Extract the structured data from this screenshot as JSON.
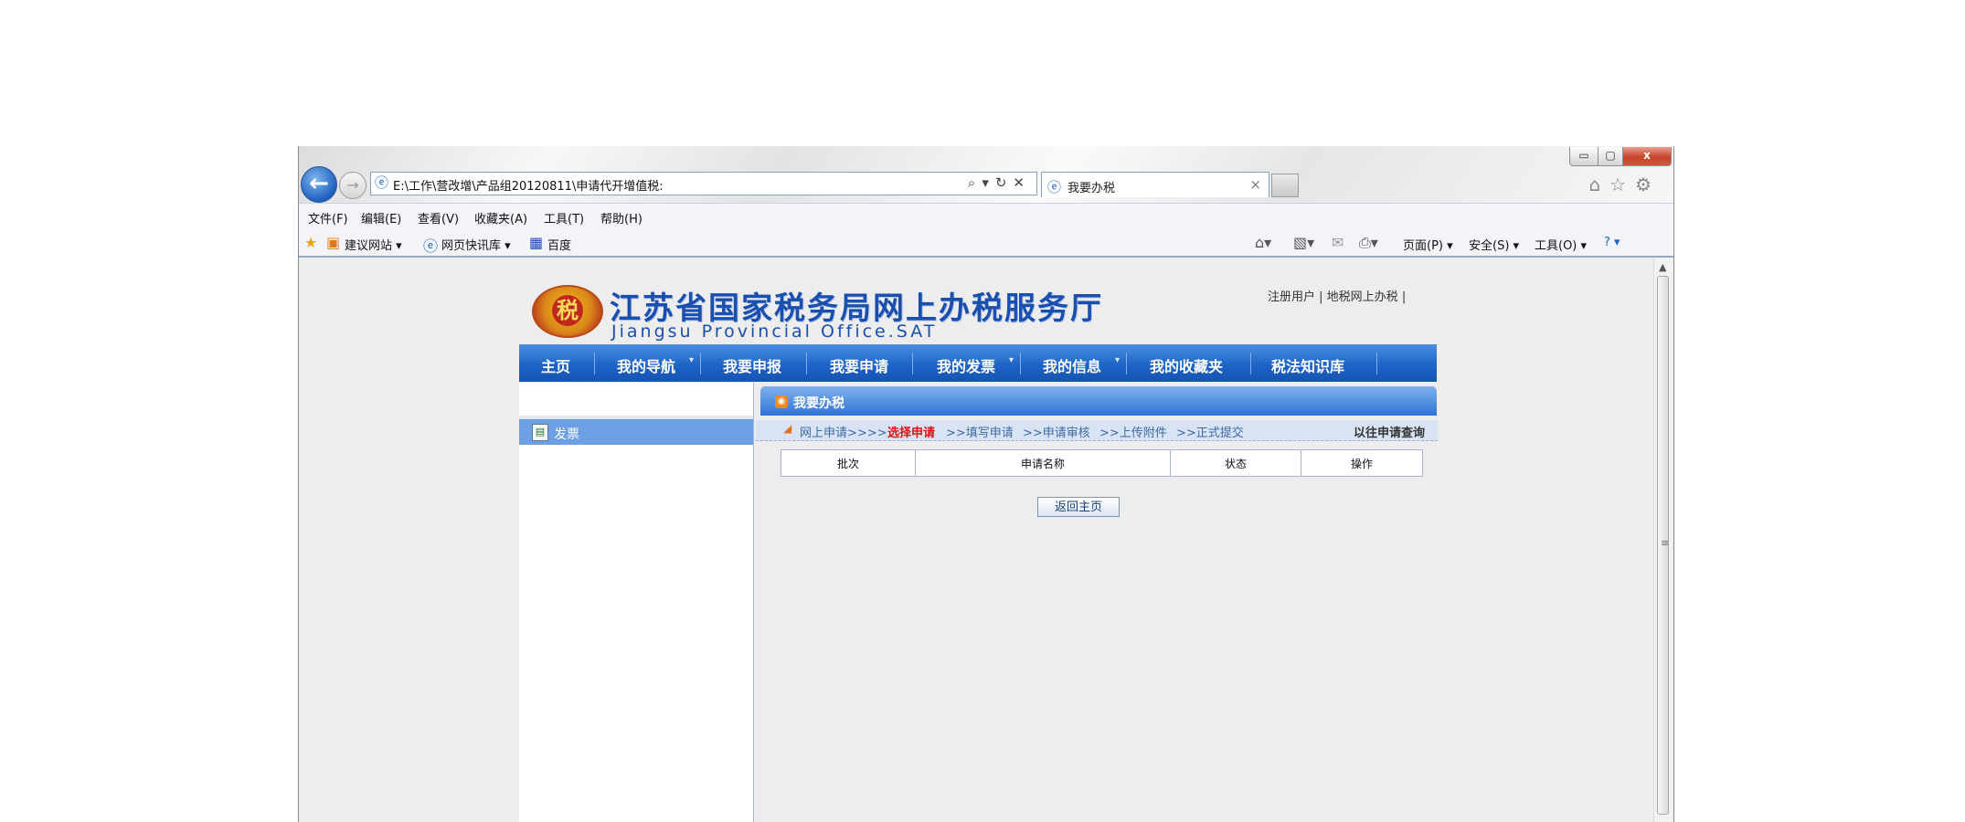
{
  "browser": {
    "address": "E:\\工作\\营改增\\产品组20120811\\申请代开增值税:",
    "tab_title": "我要办税",
    "window_buttons": {
      "minimize": "▭",
      "maximize": "▢",
      "close": "x"
    },
    "menu": [
      "文件(F)",
      "编辑(E)",
      "查看(V)",
      "收藏夹(A)",
      "工具(T)",
      "帮助(H)"
    ],
    "favorites": [
      "建议网站 ▾",
      "网页快讯库 ▾",
      "百度"
    ],
    "commandbar": {
      "page": "页面(P) ▾",
      "safety": "安全(S) ▾",
      "tools": "工具(O) ▾",
      "help": "? ▾"
    }
  },
  "site": {
    "logo_char": "税",
    "title": "江苏省国家税务局网上办税服务厅",
    "subtitle": "Jiangsu Provincial Office.SAT",
    "top_links": [
      "注册用户",
      "地税网上办税"
    ],
    "nav": [
      "主页",
      "我的导航",
      "我要申报",
      "我要申请",
      "我的发票",
      "我的信息",
      "我的收藏夹",
      "税法知识库"
    ]
  },
  "sidebar": {
    "item": "发票"
  },
  "panel": {
    "title": "我要办税",
    "steps": {
      "prefix": "网上申请>>>>",
      "current": "选择申请",
      "rest": [
        ">>填写申请",
        ">>申请审核",
        ">>上传附件",
        ">>正式提交"
      ],
      "history": "以往申请查询"
    },
    "table_headers": [
      "批次",
      "申请名称",
      "状态",
      "操作"
    ],
    "back_button": "返回主页"
  }
}
